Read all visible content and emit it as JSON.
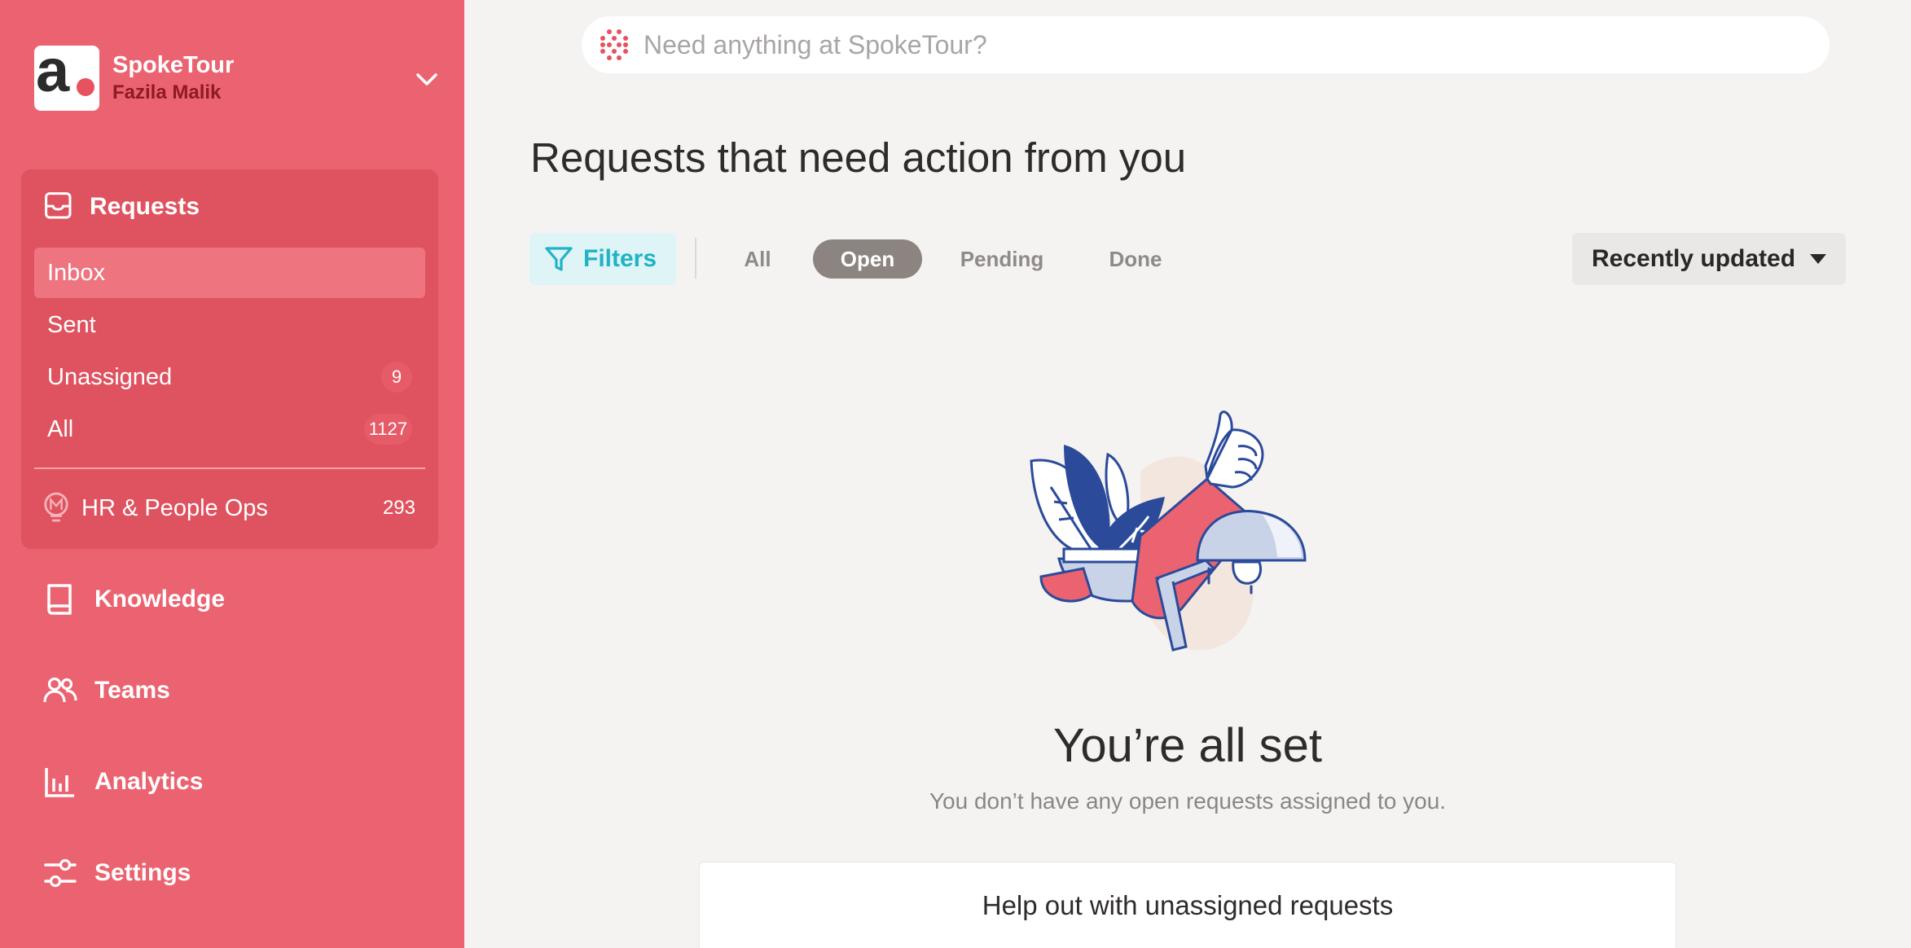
{
  "workspace": {
    "name": "SpokeTour",
    "user": "Fazila Malik",
    "logo_letter": "a"
  },
  "sidebar": {
    "requests_label": "Requests",
    "sub_items": [
      {
        "label": "Inbox",
        "count": ""
      },
      {
        "label": "Sent",
        "count": ""
      },
      {
        "label": "Unassigned",
        "count": "9"
      },
      {
        "label": "All",
        "count": "1127"
      }
    ],
    "team": {
      "label": "HR & People Ops",
      "count": "293"
    },
    "nav": [
      {
        "label": "Knowledge",
        "icon": "book-icon"
      },
      {
        "label": "Teams",
        "icon": "people-icon"
      },
      {
        "label": "Analytics",
        "icon": "bar-chart-icon"
      },
      {
        "label": "Settings",
        "icon": "sliders-icon"
      }
    ]
  },
  "search": {
    "placeholder": "Need anything at SpokeTour?"
  },
  "main": {
    "title": "Requests that need action from you",
    "filters_label": "Filters",
    "tabs": [
      {
        "label": "All",
        "active": false
      },
      {
        "label": "Open",
        "active": true
      },
      {
        "label": "Pending",
        "active": false
      },
      {
        "label": "Done",
        "active": false
      }
    ],
    "sort_label": "Recently updated",
    "empty_title": "You’re all set",
    "empty_subtitle": "You don’t have any open requests assigned to you.",
    "help_card_label": "Help out with unassigned requests"
  },
  "colors": {
    "sidebar": "#eb6370",
    "sidebar_box": "#de535f",
    "accent_teal": "#20b2c6",
    "active_tab": "#8b8480"
  }
}
